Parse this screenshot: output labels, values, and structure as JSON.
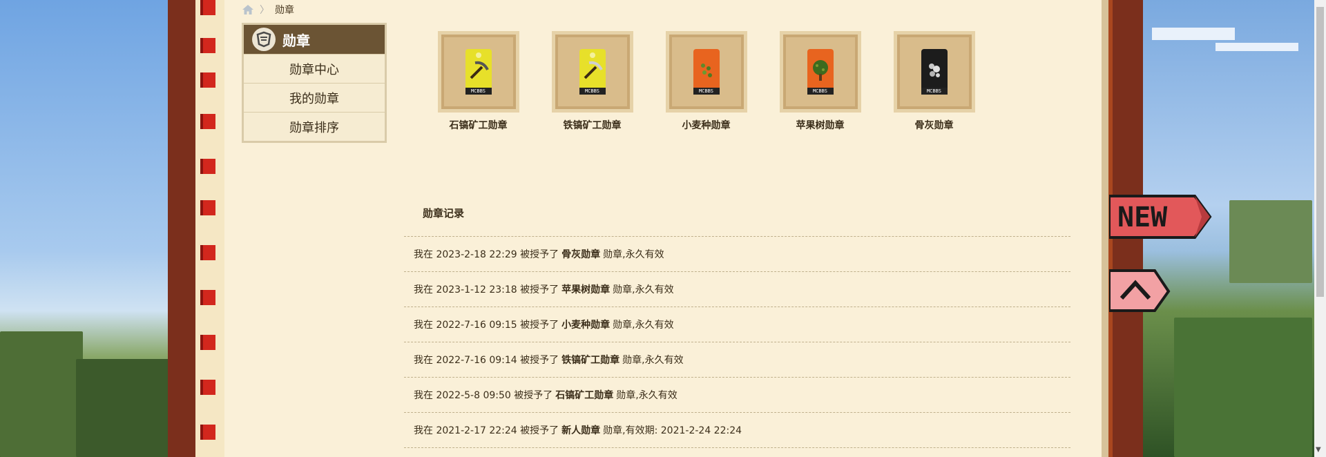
{
  "breadcrumb": {
    "current": "勋章"
  },
  "sidebar": {
    "title": "勋章",
    "items": [
      {
        "label": "勋章中心"
      },
      {
        "label": "我的勋章"
      },
      {
        "label": "勋章排序"
      }
    ]
  },
  "medals": [
    {
      "name": "石镐矿工勋章",
      "tag_text": "MCBBS",
      "color": "#e7e02a",
      "icon": "pickaxe-icon"
    },
    {
      "name": "铁镐矿工勋章",
      "tag_text": "MCBBS",
      "color": "#e7e02a",
      "icon": "pickaxe-icon"
    },
    {
      "name": "小麦种勋章",
      "tag_text": "MCBBS",
      "color": "#e8641f",
      "icon": "wheat-seeds-icon"
    },
    {
      "name": "苹果树勋章",
      "tag_text": "MCBBS",
      "color": "#e8641f",
      "icon": "apple-tree-icon"
    },
    {
      "name": "骨灰勋章",
      "tag_text": "MCBBS",
      "color": "#1c1c1c",
      "icon": "bone-meal-icon"
    }
  ],
  "records": {
    "title": "勋章记录",
    "rows": [
      {
        "prefix": "我在 2023-2-18 22:29 被授予了",
        "medal": "骨灰勋章",
        "suffix": "勋章,永久有效"
      },
      {
        "prefix": "我在 2023-1-12 23:18 被授予了",
        "medal": "苹果树勋章",
        "suffix": "勋章,永久有效"
      },
      {
        "prefix": "我在 2022-7-16 09:15 被授予了",
        "medal": "小麦种勋章",
        "suffix": "勋章,永久有效"
      },
      {
        "prefix": "我在 2022-7-16 09:14 被授予了",
        "medal": "铁镐矿工勋章",
        "suffix": "勋章,永久有效"
      },
      {
        "prefix": "我在 2022-5-8 09:50 被授予了",
        "medal": "石镐矿工勋章",
        "suffix": "勋章,永久有效"
      },
      {
        "prefix": "我在 2021-2-17 22:24 被授予了",
        "medal": "新人勋章",
        "suffix": "勋章,有效期: 2021-2-24 22:24"
      }
    ]
  },
  "side_flags": {
    "new_label": "NEW"
  }
}
